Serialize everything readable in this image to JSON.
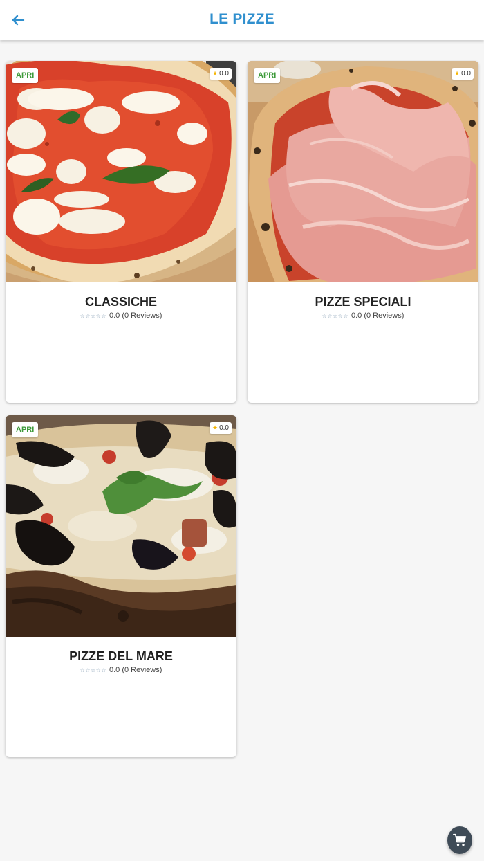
{
  "header": {
    "title": "LE PIZZE",
    "back_icon": "arrow-left-icon"
  },
  "colors": {
    "accent": "#2f8fce",
    "open_badge": "#3d9a3a",
    "star": "#f5b400",
    "star_empty": "#8aa1b6",
    "fab": "#3f4b57"
  },
  "cards": [
    {
      "title": "CLASSICHE",
      "status": "APRI",
      "rating": "0.0",
      "reviews": "0.0 (0 Reviews)",
      "stars": "☆☆☆☆☆"
    },
    {
      "title": "PIZZE SPECIALI",
      "status": "APRI",
      "rating": "0.0",
      "reviews": "0.0 (0 Reviews)",
      "stars": "☆☆☆☆☆"
    },
    {
      "title": "PIZZE DEL MARE",
      "status": "APRI",
      "rating": "0.0",
      "reviews": "0.0 (0 Reviews)",
      "stars": "☆☆☆☆☆"
    }
  ],
  "fab": {
    "icon": "cart-icon"
  }
}
